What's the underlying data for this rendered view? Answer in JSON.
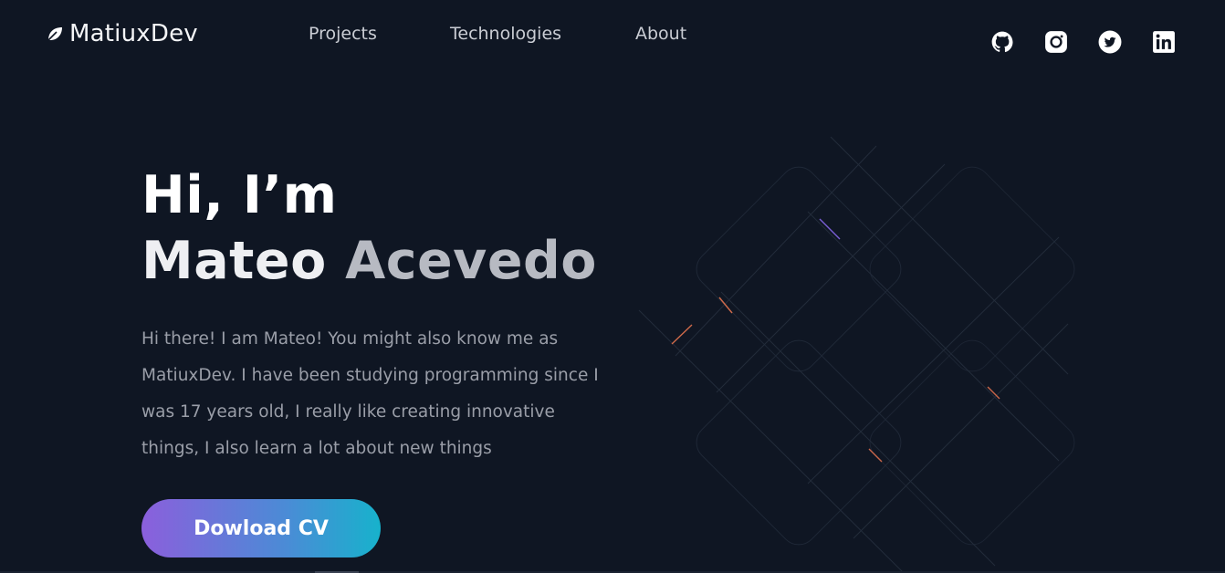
{
  "brand": {
    "name": "MatiuxDev",
    "icon": "leaf-icon"
  },
  "nav": {
    "items": [
      {
        "label": "Projects"
      },
      {
        "label": "Technologies"
      },
      {
        "label": "About"
      }
    ]
  },
  "socials": [
    {
      "icon": "github-icon"
    },
    {
      "icon": "instagram-icon"
    },
    {
      "icon": "twitter-icon"
    },
    {
      "icon": "linkedin-icon"
    }
  ],
  "hero": {
    "greeting": "Hi, I’m",
    "first_name": "Mateo",
    "last_name": "Acevedo",
    "intro": "Hi there! I am Mateo! You might also know me as MatiuxDev. I have been studying programming since I was 17 years old, I really like creating innovative things, I also learn a lot about new things",
    "cta_label": "Dowload CV"
  },
  "colors": {
    "background": "#0f1623",
    "cta_gradient_start": "#8b5fdc",
    "cta_gradient_end": "#17b2cc"
  }
}
